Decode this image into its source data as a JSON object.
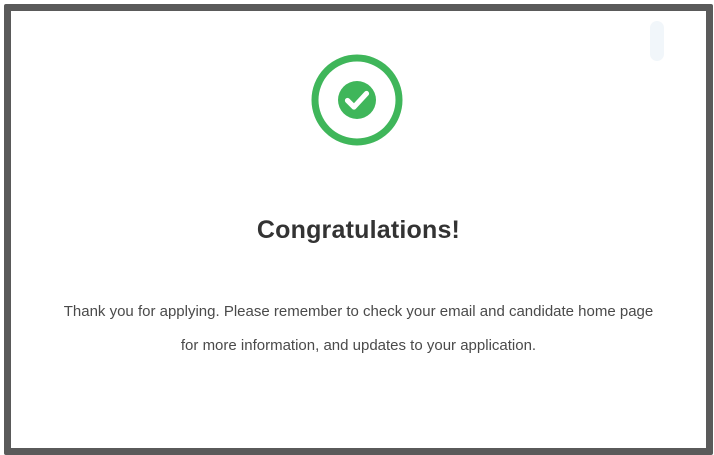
{
  "dialog": {
    "title": "Congratulations!",
    "message": "Thank you for applying. Please remember to check your email and candidate home page for more information, and updates to your application.",
    "icon": "check-circle-icon"
  },
  "colors": {
    "success_green": "#3fb65a",
    "frame_border": "#5a5a5a",
    "title_text": "#333333",
    "body_text": "#4a4a4a"
  }
}
